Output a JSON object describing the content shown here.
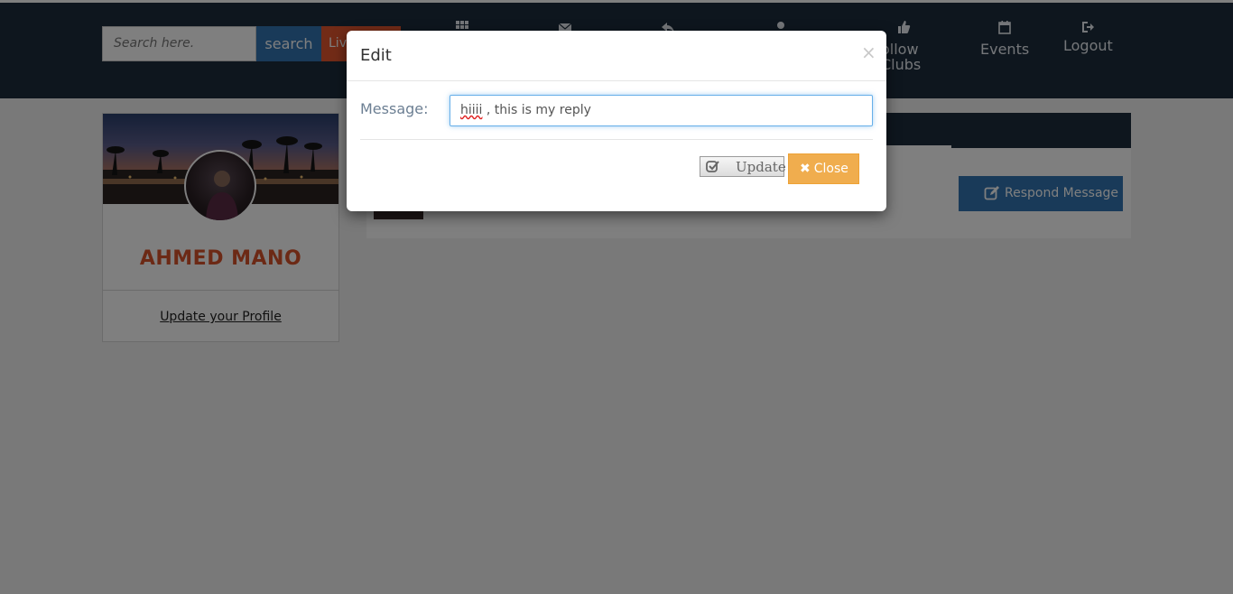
{
  "header": {
    "search_placeholder": "Search here.",
    "search_label": "search",
    "live_label": "Live",
    "nav": [
      {
        "label": "",
        "icon": "grid-icon"
      },
      {
        "label": "",
        "icon": "envelope-icon"
      },
      {
        "label": "",
        "icon": "reply-icon"
      },
      {
        "label": "",
        "icon": "user-icon"
      },
      {
        "label": "ollow Clubs",
        "icon": "thumbs-up-icon"
      },
      {
        "label": "Events",
        "icon": "calendar-icon"
      },
      {
        "label": "Logout",
        "icon": "logout-icon"
      }
    ]
  },
  "profile": {
    "name": "AHMED MANO",
    "update_link": "Update your Profile"
  },
  "message_panel": {
    "respond_label": "Respond Message"
  },
  "modal": {
    "title": "Edit",
    "close_symbol": "×",
    "message_label": "Message:",
    "message_value_misspelled": "hiiii",
    "message_value_rest": " , this is my reply",
    "update_label": "Update",
    "close_label": "Close"
  },
  "colors": {
    "navbar": "#1d2d3c",
    "search_button": "#3275b2",
    "live_button": "#e4572e",
    "profile_name": "#d9532b",
    "close_button": "#f0ad4e"
  }
}
